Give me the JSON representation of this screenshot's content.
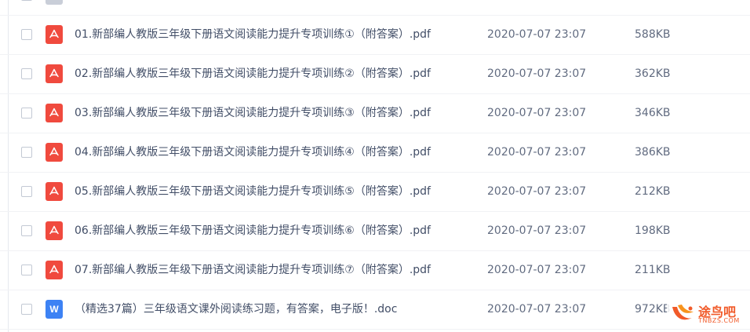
{
  "files": [
    {
      "type": "folder",
      "name": "",
      "date": "",
      "size": ""
    },
    {
      "type": "pdf",
      "name": "01.新部编人教版三年级下册语文阅读能力提升专项训练①（附答案）.pdf",
      "date": "2020-07-07 23:07",
      "size": "588KB"
    },
    {
      "type": "pdf",
      "name": "02.新部编人教版三年级下册语文阅读能力提升专项训练②（附答案）.pdf",
      "date": "2020-07-07 23:07",
      "size": "362KB"
    },
    {
      "type": "pdf",
      "name": "03.新部编人教版三年级下册语文阅读能力提升专项训练③（附答案）.pdf",
      "date": "2020-07-07 23:07",
      "size": "346KB"
    },
    {
      "type": "pdf",
      "name": "04.新部编人教版三年级下册语文阅读能力提升专项训练④（附答案）.pdf",
      "date": "2020-07-07 23:07",
      "size": "386KB"
    },
    {
      "type": "pdf",
      "name": "05.新部编人教版三年级下册语文阅读能力提升专项训练⑤（附答案）.pdf",
      "date": "2020-07-07 23:07",
      "size": "212KB"
    },
    {
      "type": "pdf",
      "name": "06.新部编人教版三年级下册语文阅读能力提升专项训练⑥（附答案）.pdf",
      "date": "2020-07-07 23:07",
      "size": "198KB"
    },
    {
      "type": "pdf",
      "name": "07.新部编人教版三年级下册语文阅读能力提升专项训练⑦（附答案）.pdf",
      "date": "2020-07-07 23:07",
      "size": "211KB"
    },
    {
      "type": "doc",
      "name": "（精选37篇）三年级语文课外阅读练习题，有答案，电子版！.doc",
      "date": "2020-07-07 23:07",
      "size": "972KB"
    }
  ],
  "icons": {
    "pdf": "pdf-file-icon",
    "doc": "word-file-icon",
    "folder": "folder-icon",
    "doc_letter": "W"
  },
  "colors": {
    "pdf": "#f04a3e",
    "doc": "#3d82f4",
    "text": "#424e67",
    "watermark": "#f15a29"
  },
  "watermark": {
    "text": "途鸟吧",
    "sub": "TNBZS.COM"
  }
}
